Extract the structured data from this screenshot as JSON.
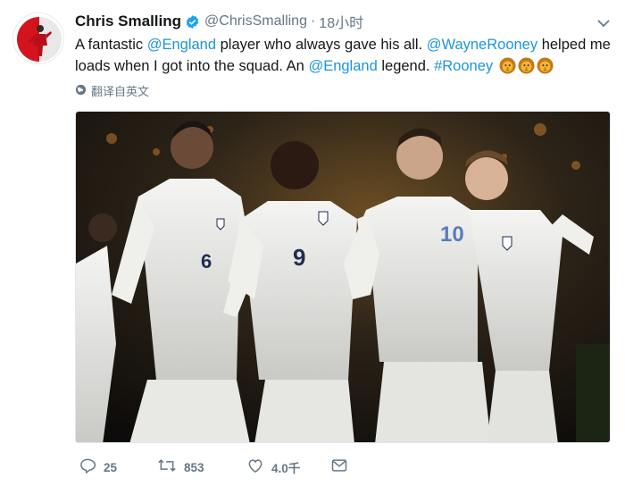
{
  "tweet": {
    "author_name": "Chris Smalling",
    "author_handle": "@ChrisSmalling",
    "separator": "·",
    "timestamp": "18小时",
    "text": {
      "part1": "A fantastic ",
      "mention1": "@England",
      "part2": " player who always gave his all. ",
      "mention2": "@WayneRooney",
      "part3": " helped me loads when I got into the squad. An ",
      "mention3": "@England",
      "part4": " legend. ",
      "hashtag": "#Rooney"
    },
    "emoji": [
      "lion-emoji",
      "lion-emoji",
      "lion-emoji"
    ],
    "translate_label": "翻译自英文",
    "photo": {
      "shirt_numbers": [
        "6",
        "9",
        "10"
      ]
    }
  },
  "actions": {
    "replies": "25",
    "retweets": "853",
    "likes": "4.0千"
  },
  "colors": {
    "link": "#1b95e0",
    "secondary": "#657786",
    "verified": "#1da1f2"
  },
  "icons": [
    "avatar",
    "verified-badge-icon",
    "chevron-down-icon",
    "globe-icon",
    "reply-icon",
    "retweet-icon",
    "like-icon",
    "message-icon"
  ]
}
